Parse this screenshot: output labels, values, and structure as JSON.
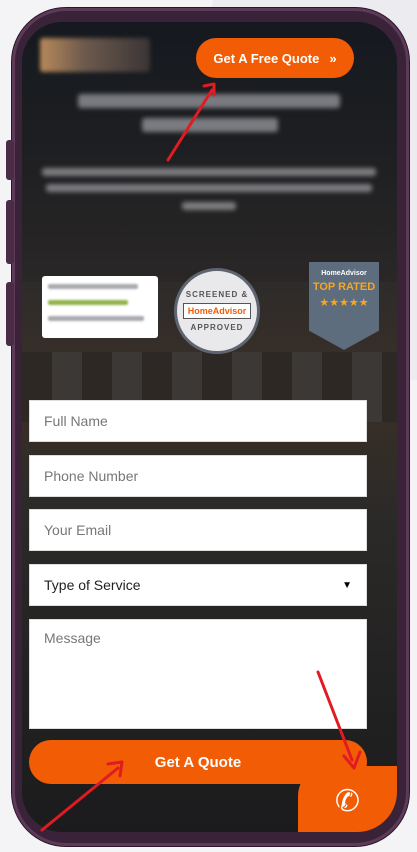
{
  "header": {
    "cta_label": "Get A Free Quote",
    "cta_icon": "double-chevron-right-icon"
  },
  "badges": {
    "screened_top": "SCREENED &",
    "screened_brand": "HomeAdvisor",
    "screened_bottom": "APPROVED",
    "toprated_brand": "HomeAdvisor",
    "toprated_text": "TOP RATED",
    "toprated_stars": "★★★★★"
  },
  "form": {
    "full_name_placeholder": "Full Name",
    "phone_placeholder": "Phone Number",
    "email_placeholder": "Your Email",
    "service_selected": "Type of Service",
    "message_placeholder": "Message",
    "submit_label": "Get A Quote"
  },
  "call": {
    "icon": "phone-icon"
  },
  "colors": {
    "accent": "#f25c05",
    "annotation": "#e11b22",
    "frame": "#3a2338"
  }
}
